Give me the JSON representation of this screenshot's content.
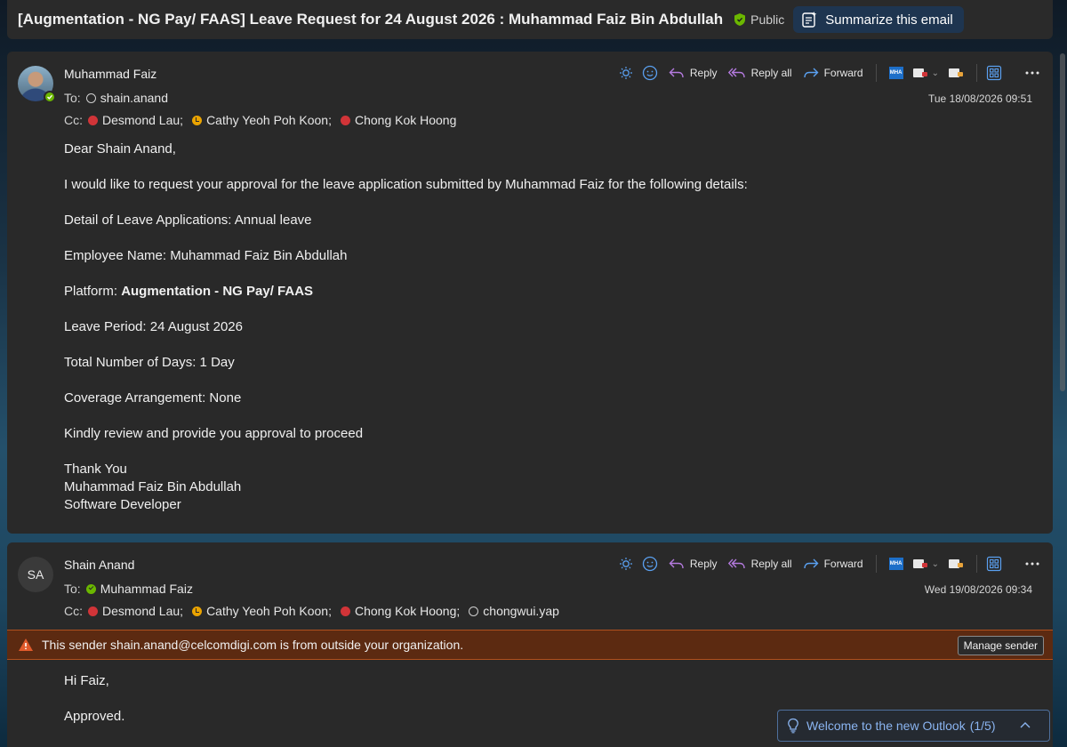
{
  "header": {
    "subject": "[Augmentation - NG Pay/ FAAS] Leave Request for 24 August 2026 : Muhammad Faiz Bin Abdullah",
    "sensitivity": "Public",
    "summarize_label": "Summarize this email"
  },
  "actions": {
    "reply": "Reply",
    "reply_all": "Reply all",
    "forward": "Forward",
    "addin_label": "MHA"
  },
  "message1": {
    "sender": "Muhammad Faiz",
    "to_label": "To:",
    "to": "shain.anand",
    "cc_label": "Cc:",
    "cc": [
      {
        "name": "Desmond Lau;",
        "status": "busy"
      },
      {
        "name": "Cathy Yeoh Poh Koon;",
        "status": "away"
      },
      {
        "name": "Chong Kok Hoong",
        "status": "busy"
      }
    ],
    "date": "Tue 18/08/2026 09:51",
    "body": {
      "greeting": "Dear Shain Anand,",
      "p1": "I would like to request your approval for the leave application submitted by Muhammad Faiz for the following details:",
      "p2": "Detail of Leave Applications: Annual leave",
      "p3": "Employee Name: Muhammad Faiz Bin Abdullah",
      "p4_label": "Platform: ",
      "p4_value": "Augmentation - NG Pay/ FAAS",
      "p5": "Leave Period: 24 August 2026",
      "p6": "Total Number of Days: 1 Day",
      "p7": "Coverage Arrangement: None",
      "p8": "Kindly review and provide you approval to proceed",
      "sig1": "Thank You",
      "sig2": "Muhammad Faiz Bin Abdullah",
      "sig3": "Software Developer"
    }
  },
  "message2": {
    "initials": "SA",
    "sender": "Shain Anand",
    "to_label": "To:",
    "to": "Muhammad Faiz",
    "cc_label": "Cc:",
    "cc": [
      {
        "name": "Desmond Lau;",
        "status": "busy"
      },
      {
        "name": "Cathy Yeoh Poh Koon;",
        "status": "away"
      },
      {
        "name": "Chong Kok Hoong;",
        "status": "busy"
      },
      {
        "name": "chongwui.yap",
        "status": "offline"
      }
    ],
    "date": "Wed 19/08/2026 09:34",
    "warning": "This sender shain.anand@celcomdigi.com is from outside your organization.",
    "manage_sender": "Manage sender",
    "body": {
      "greeting": "Hi Faiz,",
      "p1": "Approved."
    }
  },
  "toast": {
    "label": "Welcome to the new Outlook",
    "progress": "(1/5)"
  },
  "colors": {
    "card_bg": "#292929",
    "banner_bg": "#5c2a11",
    "busy": "#d13438",
    "away": "#eaa300",
    "available": "#6bb700",
    "accent": "#8ab4f0"
  }
}
